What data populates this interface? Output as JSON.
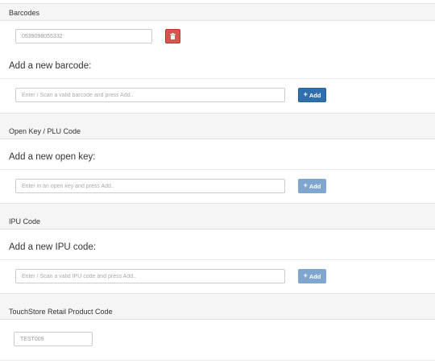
{
  "barcodes": {
    "header": "Barcodes",
    "existing_value": "0539098055332",
    "add_title": "Add a new barcode:",
    "placeholder": "Enter / Scan a valid barcode and press Add..",
    "add_label": "Add"
  },
  "open_key": {
    "header": "Open Key / PLU Code",
    "add_title": "Add a new open key:",
    "placeholder": "Enter in an open key and press Add..",
    "add_label": "Add"
  },
  "ipu": {
    "header": "IPU Code",
    "add_title": "Add a new IPU code:",
    "placeholder": "Enter / Scan a valid IPU code and press Add..",
    "add_label": "Add"
  },
  "touchstore": {
    "header": "TouchStore Retail Product Code",
    "value": "TEST009"
  },
  "colors": {
    "add_active": "#2f6fae",
    "add_disabled": "#7ea6cf",
    "delete": "#d9534f"
  },
  "icons": [
    "trash-icon",
    "plus-icon"
  ]
}
